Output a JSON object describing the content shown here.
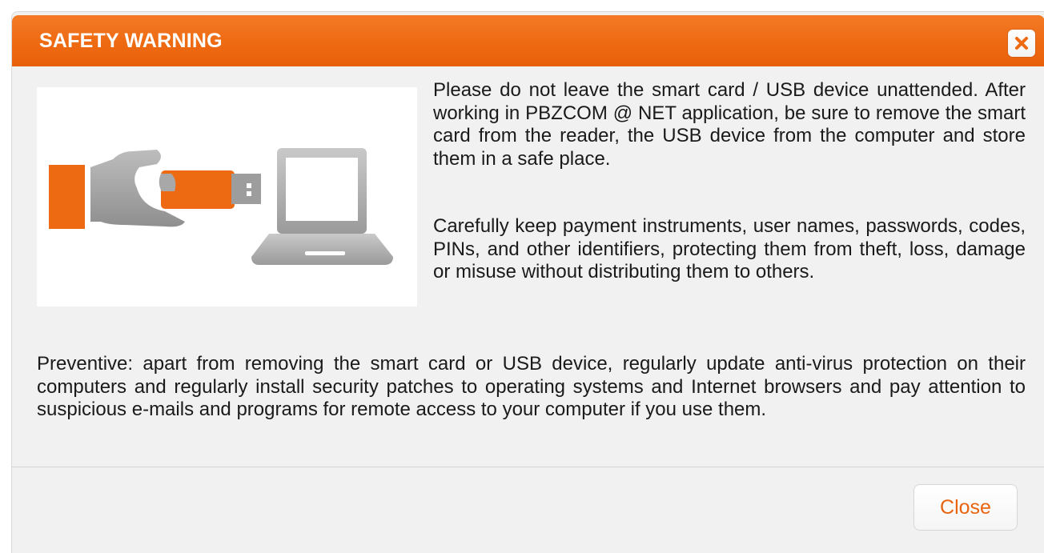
{
  "dialog": {
    "title": "SAFETY WARNING",
    "close_icon": "close-x-icon",
    "accent_color": "#ee6a12",
    "illustration": "usb-device-laptop-illustration",
    "paragraphs": [
      "Please do not leave the smart card / USB device unattended. After working in PBZCOM @ NET application, be sure to remove the smart card from the reader, the USB device from the computer and store them in a safe place.",
      "Carefully keep payment instruments, user names, passwords, codes, PINs, and other identifiers, protecting them from theft, loss, damage or misuse without distributing them to others.",
      "Preventive: apart from removing the smart card or USB device, regularly update anti-virus protection on their computers and regularly install security patches to operating systems and Internet browsers and pay attention to suspicious e-mails and programs for remote access to your computer if you use them."
    ],
    "close_button_label": "Close"
  }
}
